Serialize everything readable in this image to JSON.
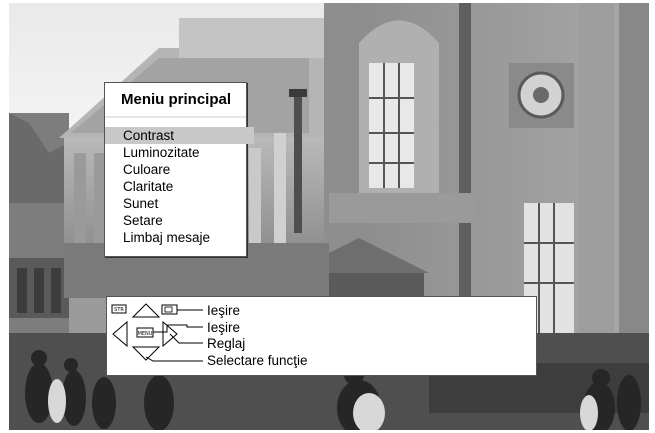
{
  "menu": {
    "title": "Meniu principal",
    "selected_index": 0,
    "items": [
      {
        "label": "Contrast"
      },
      {
        "label": "Luminozitate"
      },
      {
        "label": "Culoare"
      },
      {
        "label": "Claritate"
      },
      {
        "label": "Sunet"
      },
      {
        "label": "Setare"
      },
      {
        "label": "Limbaj mesaje"
      }
    ]
  },
  "help": {
    "keys": {
      "str": "STR",
      "menu": "MENU"
    },
    "labels": {
      "exit_str": "Ieşire",
      "exit_menu": "Ieşire",
      "adjust": "Reglaj",
      "select": "Selectare funcţie"
    }
  },
  "colors": {
    "menu_bg": "#ffffff",
    "selected_bg": "#c8c8c8",
    "photo_tone": "#9b9b9b"
  }
}
